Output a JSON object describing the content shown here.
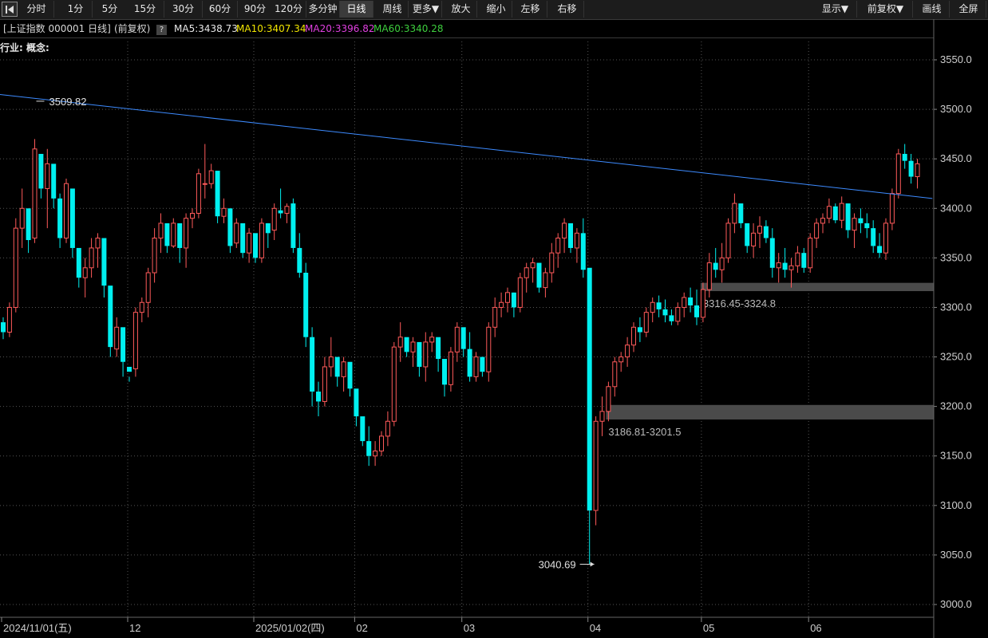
{
  "toolbar": {
    "back_icon": "play-back-icon",
    "buttons": [
      {
        "label": "分时",
        "name": "period-timeshare-button"
      },
      {
        "label": "1分",
        "name": "period-1min-button"
      },
      {
        "label": "5分",
        "name": "period-5min-button"
      },
      {
        "label": "15分",
        "name": "period-15min-button"
      },
      {
        "label": "30分",
        "name": "period-30min-button"
      },
      {
        "label": "60分",
        "name": "period-60min-button"
      },
      {
        "label": "90分",
        "name": "period-90min-button"
      },
      {
        "label": "120分",
        "name": "period-120min-button"
      },
      {
        "label": "多分钟",
        "name": "period-multimin-button"
      },
      {
        "label": "日线",
        "name": "period-daily-button",
        "active": true
      },
      {
        "label": "周线",
        "name": "period-weekly-button"
      },
      {
        "label": "更多▼",
        "name": "more-dropdown-button"
      },
      {
        "label": "放大",
        "name": "zoom-in-button"
      },
      {
        "label": "缩小",
        "name": "zoom-out-button"
      },
      {
        "label": "左移",
        "name": "move-left-button"
      },
      {
        "label": "右移",
        "name": "move-right-button"
      }
    ],
    "right_buttons": [
      {
        "label": "显示▼",
        "name": "display-dropdown-button"
      },
      {
        "label": "前复权▼",
        "name": "adjust-dropdown-button"
      },
      {
        "label": "画线",
        "name": "draw-line-button"
      },
      {
        "label": "全屏",
        "name": "fullscreen-button"
      }
    ]
  },
  "info": {
    "title": "[上证指数 000001 日线]",
    "adjust": "(前复权)",
    "help": "?",
    "ma5": "MA5:3438.73",
    "ma10": "MA10:3407.34",
    "ma20": "MA20:3396.82",
    "ma60": "MA60:3340.28",
    "colors": {
      "ma5": "#e8e8e8",
      "ma10": "#f2e600",
      "ma20": "#e040e0",
      "ma60": "#3ecf3e"
    }
  },
  "industry_label": "行业: 概念:",
  "chart_data": {
    "type": "candlestick",
    "ylim": [
      3000,
      3550
    ],
    "y_ticks": [
      "3550.0",
      "3500.0",
      "3450.0",
      "3400.0",
      "3350.0",
      "3300.0",
      "3250.0",
      "3200.0",
      "3150.0",
      "3100.0",
      "3050.0",
      "3000.0"
    ],
    "x_labels": [
      "2024/11/01(五)",
      "12",
      "2025/01/02(四)",
      "02",
      "03",
      "04",
      "05",
      "06"
    ],
    "x_label_index": [
      0,
      20,
      40,
      56,
      73,
      93,
      111,
      128
    ],
    "colors": {
      "up": "#ff5a5a",
      "down": "#00f0f0",
      "trendline": "#3d8bff",
      "band": "#4a4a4a",
      "grid": "#555555",
      "axis_text": "#cfcfcf"
    },
    "annotations": {
      "high": {
        "label": "3509.82",
        "value": 3509.82,
        "index": 5
      },
      "low": {
        "label": "3040.69",
        "value": 3040.69,
        "index": 94
      },
      "band_1": {
        "label": "3316.45-3324.8",
        "low": 3316.45,
        "high": 3324.8,
        "from_index": 111
      },
      "band_2": {
        "label": "3186.81-3201.5",
        "low": 3186.81,
        "high": 3201.5,
        "from_index": 96
      }
    },
    "trendline": {
      "from": [
        0,
        3515
      ],
      "to": [
        147,
        3410
      ]
    },
    "candles": [
      [
        3285,
        3290,
        3268,
        3275
      ],
      [
        3275,
        3305,
        3270,
        3300
      ],
      [
        3300,
        3390,
        3295,
        3380
      ],
      [
        3380,
        3420,
        3360,
        3400
      ],
      [
        3400,
        3370,
        3355,
        3368
      ],
      [
        3370,
        3470,
        3365,
        3460
      ],
      [
        3455,
        3440,
        3410,
        3420
      ],
      [
        3420,
        3460,
        3380,
        3445
      ],
      [
        3445,
        3420,
        3400,
        3410
      ],
      [
        3410,
        3415,
        3360,
        3370
      ],
      [
        3370,
        3430,
        3365,
        3425
      ],
      [
        3420,
        3390,
        3350,
        3360
      ],
      [
        3360,
        3345,
        3320,
        3330
      ],
      [
        3330,
        3350,
        3310,
        3340
      ],
      [
        3340,
        3370,
        3330,
        3360
      ],
      [
        3360,
        3375,
        3340,
        3370
      ],
      [
        3370,
        3330,
        3310,
        3322
      ],
      [
        3322,
        3265,
        3250,
        3260
      ],
      [
        3258,
        3290,
        3250,
        3280
      ],
      [
        3280,
        3250,
        3230,
        3245
      ],
      [
        3240,
        3230,
        3225,
        3235
      ],
      [
        3238,
        3300,
        3230,
        3295
      ],
      [
        3295,
        3310,
        3285,
        3305
      ],
      [
        3305,
        3340,
        3290,
        3335
      ],
      [
        3335,
        3380,
        3325,
        3370
      ],
      [
        3370,
        3395,
        3355,
        3385
      ],
      [
        3385,
        3370,
        3355,
        3362
      ],
      [
        3362,
        3390,
        3360,
        3385
      ],
      [
        3385,
        3370,
        3345,
        3360
      ],
      [
        3360,
        3395,
        3340,
        3390
      ],
      [
        3390,
        3400,
        3380,
        3395
      ],
      [
        3395,
        3440,
        3390,
        3435
      ],
      [
        3425,
        3465,
        3410,
        3425
      ],
      [
        3425,
        3445,
        3420,
        3438
      ],
      [
        3438,
        3400,
        3385,
        3392
      ],
      [
        3392,
        3410,
        3385,
        3400
      ],
      [
        3400,
        3380,
        3355,
        3362
      ],
      [
        3365,
        3390,
        3360,
        3385
      ],
      [
        3385,
        3360,
        3350,
        3355
      ],
      [
        3355,
        3380,
        3345,
        3375
      ],
      [
        3375,
        3365,
        3345,
        3350
      ],
      [
        3350,
        3390,
        3345,
        3385
      ],
      [
        3385,
        3385,
        3360,
        3375
      ],
      [
        3378,
        3405,
        3368,
        3400
      ],
      [
        3398,
        3420,
        3390,
        3395
      ],
      [
        3395,
        3405,
        3385,
        3402
      ],
      [
        3405,
        3410,
        3355,
        3360
      ],
      [
        3360,
        3375,
        3330,
        3335
      ],
      [
        3335,
        3345,
        3260,
        3270
      ],
      [
        3270,
        3280,
        3200,
        3215
      ],
      [
        3215,
        3225,
        3190,
        3205
      ],
      [
        3205,
        3250,
        3200,
        3240
      ],
      [
        3240,
        3270,
        3230,
        3250
      ],
      [
        3250,
        3240,
        3220,
        3230
      ],
      [
        3230,
        3250,
        3215,
        3245
      ],
      [
        3245,
        3235,
        3210,
        3218
      ],
      [
        3218,
        3210,
        3180,
        3190
      ],
      [
        3190,
        3175,
        3160,
        3165
      ],
      [
        3165,
        3180,
        3140,
        3150
      ],
      [
        3150,
        3165,
        3140,
        3155
      ],
      [
        3155,
        3175,
        3150,
        3170
      ],
      [
        3170,
        3195,
        3160,
        3185
      ],
      [
        3185,
        3265,
        3180,
        3260
      ],
      [
        3260,
        3285,
        3245,
        3270
      ],
      [
        3270,
        3265,
        3250,
        3255
      ],
      [
        3255,
        3270,
        3240,
        3265
      ],
      [
        3265,
        3250,
        3230,
        3240
      ],
      [
        3240,
        3275,
        3225,
        3265
      ],
      [
        3265,
        3275,
        3255,
        3270
      ],
      [
        3270,
        3255,
        3235,
        3248
      ],
      [
        3248,
        3240,
        3210,
        3222
      ],
      [
        3222,
        3260,
        3215,
        3255
      ],
      [
        3255,
        3285,
        3245,
        3280
      ],
      [
        3280,
        3275,
        3250,
        3258
      ],
      [
        3258,
        3275,
        3225,
        3230
      ],
      [
        3230,
        3255,
        3225,
        3250
      ],
      [
        3250,
        3245,
        3230,
        3235
      ],
      [
        3235,
        3285,
        3225,
        3280
      ],
      [
        3280,
        3310,
        3270,
        3300
      ],
      [
        3300,
        3315,
        3290,
        3305
      ],
      [
        3305,
        3320,
        3295,
        3315
      ],
      [
        3315,
        3315,
        3290,
        3300
      ],
      [
        3300,
        3335,
        3295,
        3330
      ],
      [
        3330,
        3345,
        3315,
        3340
      ],
      [
        3340,
        3350,
        3325,
        3345
      ],
      [
        3345,
        3335,
        3315,
        3320
      ],
      [
        3320,
        3340,
        3310,
        3335
      ],
      [
        3335,
        3365,
        3325,
        3355
      ],
      [
        3355,
        3375,
        3340,
        3370
      ],
      [
        3370,
        3390,
        3355,
        3385
      ],
      [
        3385,
        3380,
        3355,
        3360
      ],
      [
        3360,
        3380,
        3345,
        3375
      ],
      [
        3375,
        3390,
        3330,
        3338
      ],
      [
        3340,
        3105,
        3040.69,
        3095
      ],
      [
        3095,
        3190,
        3080,
        3185
      ],
      [
        3185,
        3210,
        3170,
        3195
      ],
      [
        3195,
        3225,
        3185,
        3220
      ],
      [
        3220,
        3250,
        3210,
        3245
      ],
      [
        3245,
        3255,
        3235,
        3250
      ],
      [
        3250,
        3270,
        3240,
        3262
      ],
      [
        3262,
        3285,
        3255,
        3280
      ],
      [
        3280,
        3290,
        3265,
        3275
      ],
      [
        3275,
        3300,
        3270,
        3295
      ],
      [
        3295,
        3310,
        3285,
        3305
      ],
      [
        3305,
        3312,
        3290,
        3298
      ],
      [
        3298,
        3308,
        3285,
        3292
      ],
      [
        3292,
        3298,
        3282,
        3286
      ],
      [
        3286,
        3305,
        3282,
        3300
      ],
      [
        3300,
        3315,
        3290,
        3310
      ],
      [
        3310,
        3320,
        3295,
        3302
      ],
      [
        3302,
        3318,
        3282,
        3290
      ],
      [
        3290,
        3325,
        3285,
        3318
      ],
      [
        3318,
        3355,
        3310,
        3345
      ],
      [
        3345,
        3360,
        3330,
        3338
      ],
      [
        3338,
        3365,
        3325,
        3350
      ],
      [
        3350,
        3390,
        3345,
        3385
      ],
      [
        3385,
        3415,
        3375,
        3405
      ],
      [
        3405,
        3400,
        3380,
        3385
      ],
      [
        3385,
        3380,
        3355,
        3362
      ],
      [
        3362,
        3385,
        3350,
        3375
      ],
      [
        3375,
        3392,
        3360,
        3382
      ],
      [
        3382,
        3388,
        3365,
        3370
      ],
      [
        3370,
        3380,
        3330,
        3340
      ],
      [
        3340,
        3355,
        3325,
        3345
      ],
      [
        3345,
        3360,
        3330,
        3338
      ],
      [
        3338,
        3350,
        3320,
        3342
      ],
      [
        3342,
        3362,
        3335,
        3355
      ],
      [
        3355,
        3360,
        3335,
        3340
      ],
      [
        3340,
        3375,
        3335,
        3370
      ],
      [
        3370,
        3390,
        3360,
        3385
      ],
      [
        3385,
        3395,
        3375,
        3390
      ],
      [
        3390,
        3410,
        3385,
        3402
      ],
      [
        3402,
        3405,
        3385,
        3388
      ],
      [
        3388,
        3412,
        3380,
        3405
      ],
      [
        3405,
        3400,
        3370,
        3378
      ],
      [
        3378,
        3395,
        3360,
        3390
      ],
      [
        3390,
        3400,
        3375,
        3385
      ],
      [
        3385,
        3395,
        3370,
        3380
      ],
      [
        3380,
        3388,
        3355,
        3362
      ],
      [
        3362,
        3375,
        3350,
        3355
      ],
      [
        3355,
        3390,
        3348,
        3385
      ],
      [
        3385,
        3420,
        3378,
        3415
      ],
      [
        3415,
        3460,
        3410,
        3455
      ],
      [
        3455,
        3465,
        3440,
        3448
      ],
      [
        3448,
        3455,
        3425,
        3432
      ],
      [
        3432,
        3450,
        3420,
        3445
      ]
    ]
  }
}
